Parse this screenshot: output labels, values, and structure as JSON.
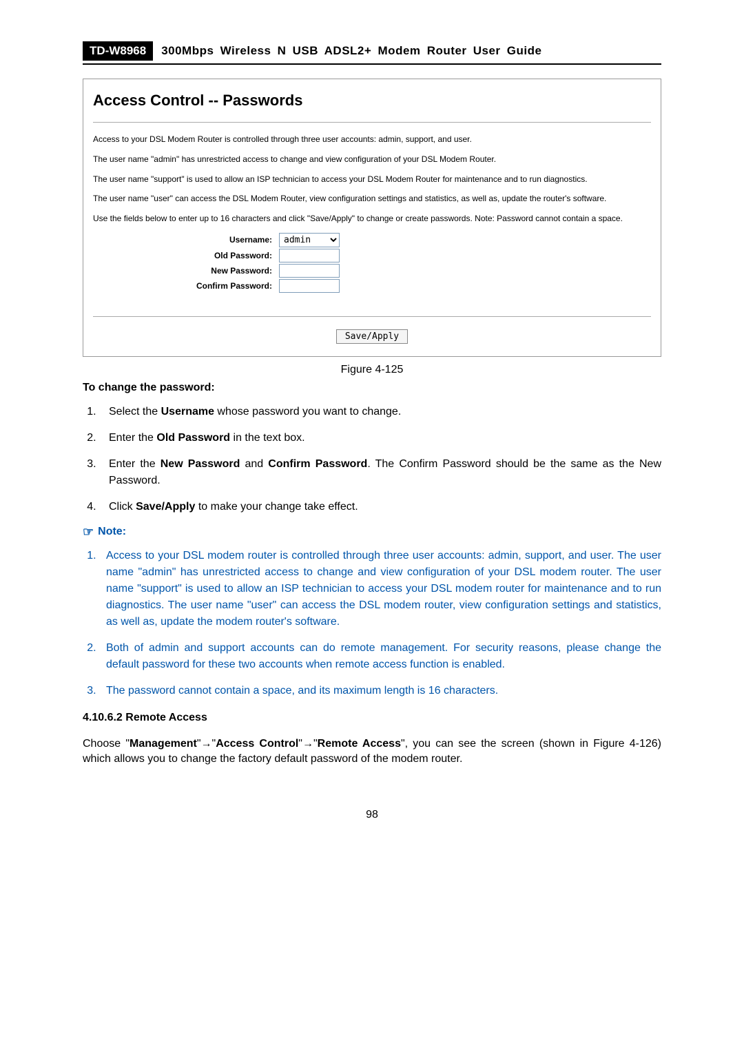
{
  "header": {
    "model": "TD-W8968",
    "title": "300Mbps Wireless N USB ADSL2+ Modem Router User Guide"
  },
  "panel": {
    "heading": "Access Control -- Passwords",
    "p1": "Access to your DSL Modem Router is controlled through three user accounts: admin, support, and user.",
    "p2": "The user name \"admin\" has unrestricted access to change and view configuration of your DSL Modem Router.",
    "p3": "The user name \"support\" is used to allow an ISP technician to access your DSL Modem Router for maintenance and to run diagnostics.",
    "p4": "The user name \"user\" can access the DSL Modem Router, view configuration settings and statistics, as well as, update the router's software.",
    "p5": "Use the fields below to enter up to 16 characters and click \"Save/Apply\" to change or create passwords. Note: Password cannot contain a space.",
    "form": {
      "username_label": "Username:",
      "username_selected": "admin",
      "old_label": "Old Password:",
      "new_label": "New Password:",
      "confirm_label": "Confirm Password:",
      "button": "Save/Apply"
    }
  },
  "figure": "Figure 4-125",
  "change_heading": "To change the password:",
  "steps": {
    "s1a": "Select the ",
    "s1b": "Username",
    "s1c": " whose password you want to change.",
    "s2a": "Enter the ",
    "s2b": "Old Password",
    "s2c": " in the text box.",
    "s3a": "Enter the ",
    "s3b": "New Password",
    "s3c": " and ",
    "s3d": "Confirm Password",
    "s3e": ". The Confirm Password should be the same as the New Password.",
    "s4a": "Click ",
    "s4b": "Save/Apply",
    "s4c": " to make your change take effect."
  },
  "note_label": "Note:",
  "notes": {
    "n1": "Access to your DSL modem router is controlled through three user accounts: admin, support, and user. The user name \"admin\" has unrestricted access to change and view configuration of your DSL modem router. The user name \"support\" is used to allow an ISP technician to access your DSL modem router for maintenance and to run diagnostics. The user name \"user\" can access the DSL modem router, view configuration settings and statistics, as well as, update the modem router's software.",
    "n2": "Both of admin and support accounts can do remote management. For security reasons, please change the default password for these two accounts when remote access function is enabled.",
    "n3": "The password cannot contain a space, and its maximum length is 16 characters."
  },
  "subsection": "4.10.6.2  Remote Access",
  "remote": {
    "a": "Choose \"",
    "b": "Management",
    "c": "\"",
    "arrow": "→",
    "d": "\"",
    "e": "Access Control",
    "f": "\"",
    "g": "\"",
    "h": "Remote Access",
    "i": "\", you can see the screen (shown in Figure 4-126) which allows you to change the factory default password of the modem router."
  },
  "page_number": "98"
}
